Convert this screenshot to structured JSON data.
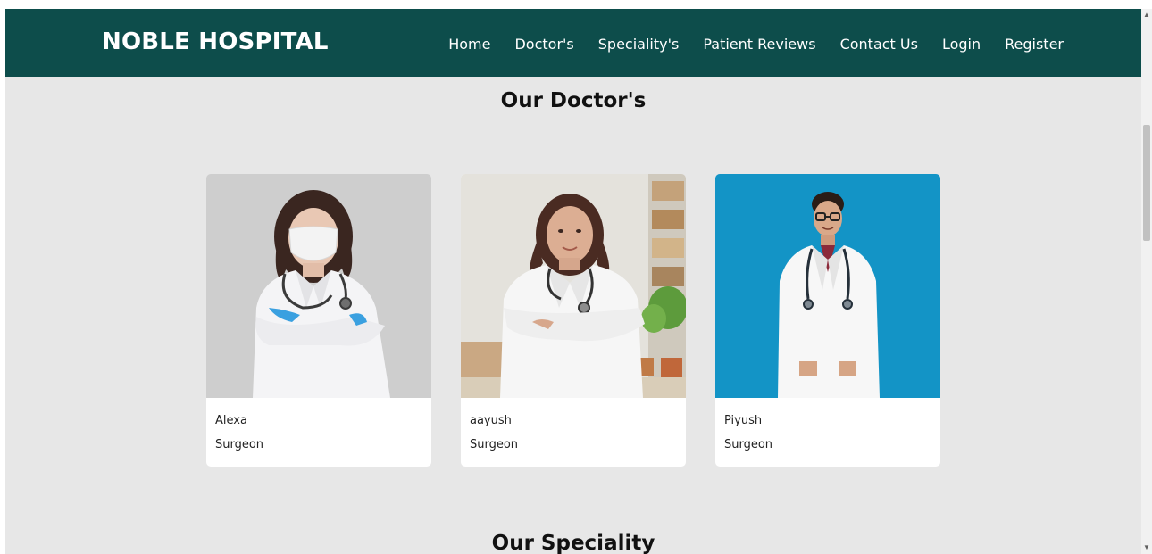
{
  "navbar": {
    "brand": "NOBLE HOSPITAL",
    "links": [
      "Home",
      "Doctor's",
      "Speciality's",
      "Patient Reviews",
      "Contact Us",
      "Login",
      "Register"
    ]
  },
  "sections": {
    "doctors_title": "Our Doctor's",
    "speciality_title": "Our Speciality"
  },
  "doctors": [
    {
      "name": "Alexa",
      "role": "Surgeon",
      "photo_bg": "#c9c9c9"
    },
    {
      "name": "aayush",
      "role": "Surgeon",
      "photo_bg": "#e4e2dc"
    },
    {
      "name": "Piyush",
      "role": "Surgeon",
      "photo_bg": "#0f8fc0"
    }
  ],
  "colors": {
    "navbar": "#0d4d4b",
    "page_bg": "#e7e7e7",
    "card_bg": "#ffffff"
  }
}
